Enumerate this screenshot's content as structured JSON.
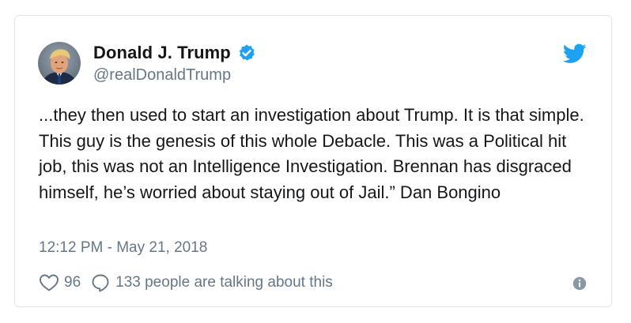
{
  "author": {
    "name": "Donald J. Trump",
    "handle": "@realDonaldTrump",
    "verified": true,
    "avatar_icon": "profile-photo"
  },
  "brand": {
    "logo_icon": "twitter-bird-icon",
    "accent_color": "#1da1f2"
  },
  "tweet": {
    "text": "...they then used to start an investigation about Trump. It is that simple. This guy is the genesis of this whole Debacle. This was a Political hit job, this was not an Intelligence Investigation. Brennan has disgraced himself, he’s worried about staying out of Jail.” Dan Bongino",
    "timestamp": "12:12 PM - May 21, 2018"
  },
  "actions": {
    "like_icon": "heart-icon",
    "like_count": "96",
    "reply_icon": "speech-bubble-icon",
    "reply_text": "133 people are talking about this",
    "info_icon": "info-icon"
  },
  "colors": {
    "text": "#14171a",
    "muted": "#657786",
    "border": "#dfe3e8"
  }
}
